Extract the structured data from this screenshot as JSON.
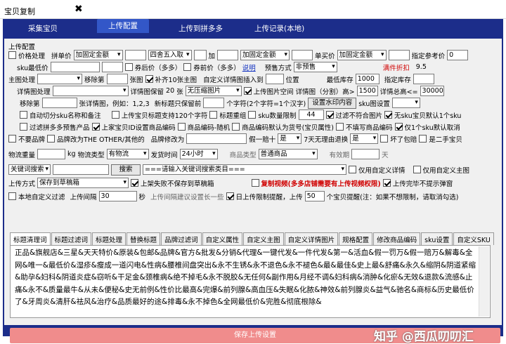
{
  "window": {
    "title": "宝贝复制",
    "close": "✖"
  },
  "nav": [
    "采集宝贝",
    "上传配置",
    "上传到拼多多",
    "上传记录(本地)"
  ],
  "section": "上传配置",
  "r1": {
    "price_cb": "价格处理",
    "group_price": "拼单价",
    "sel1": "加固定金额",
    "sel2": "四舍五入取",
    "add": "加",
    "sel3": "加固定金额",
    "single": "单买价",
    "sel4": "加固定金额",
    "ref": "指定参考价",
    "ref_val": "0"
  },
  "r2": {
    "sku_min": "sku最低价",
    "coupon": "券后价（多多）",
    "before_coupon": "券前价（多多）",
    "explain": "说明",
    "presale": "预售方式",
    "presale_val": "非预售",
    "discount": "满件折扣",
    "discount_val": "9.5"
  },
  "r3": {
    "main_img": "主图处理",
    "move": "移除第",
    "img_tail": "张图",
    "pad": "补齐10张主图",
    "custom_detail": "自定义详情图插入到",
    "pos": "位置",
    "min_stock": "最低库存",
    "min_stock_val": "1000",
    "set_stock": "指定库存"
  },
  "r4": {
    "detail_img": "详情图处理",
    "detail_keep": "详情图保留",
    "keep_num": "20",
    "sheets": "张",
    "keep_sel": "无压缩图片",
    "upload_space": "上传图片空间",
    "split": "详情图（分割）高>",
    "split_val": "1500",
    "detail_total": "详情总高<=",
    "total_val": "30000"
  },
  "r5": {
    "remove": "移除第",
    "example": "张详情图，例如：1,2,3",
    "new_title": "新标题只保留前",
    "chars": "个字符(2个字符=1个汉字)",
    "watermark_btn": "设置水印内容",
    "sku_img": "sku图设置"
  },
  "r6": {
    "auto": "自动切分sku名称和备注",
    "title_len": "上传宝贝标题支持120个字符",
    "title_dup": "标题重组",
    "sku_limit": "sku数量限制",
    "sku_limit_val": "44",
    "filter_cat": "过滤不符合图片",
    "no_sku": "无sku宝贝默认1个sku"
  },
  "r7": {
    "filter_pre": "过滤拼多多预售产品",
    "taobao_code": "上家宝贝ID设置商品编码",
    "random_code": "商品编码-随机",
    "code_default": "商品编码默认为货号(宝贝属性)",
    "no_code": "不填写商品编码",
    "only_one": "仅1个sku默认取消"
  },
  "r8": {
    "no_brand": "不要品牌",
    "brand_other": "品牌改为THE OTHER/其他的",
    "brand_mod": "品牌修改为",
    "fake": "假一赔十",
    "fake_val": "是",
    "seven": "7天无理由退换",
    "seven_val": "是",
    "broken": "坏了包赔",
    "second": "是二手宝贝"
  },
  "r9": {
    "weight": "物流重量",
    "kg": "kg",
    "logistics": "物流类型",
    "log_val": "有物流",
    "ship": "发货时间",
    "ship_val": "24小时",
    "type": "商品类型",
    "type_val": "普通商品",
    "valid": "有效期",
    "days": "天"
  },
  "r10": {
    "keyword": "关键词搜索",
    "search": "搜索",
    "kw_val": "===请输入关键词搜索类目===",
    "custom_detail": "仅用自定义详情",
    "custom_main": "仅用自定义主图"
  },
  "r11": {
    "upload_mode": "上传方式",
    "mode_val": "保存到草稿箱",
    "fail_draft": "上架失败不保存到草稿箱",
    "copy_video": "复制视频(多多店铺需要有上传视频权限)",
    "done_popup": "上传完毕不提示弹窗"
  },
  "r12": {
    "local_filter": "本地自定义过滤",
    "interval": "上传间隔",
    "interval_val": "30",
    "sec": "秒",
    "suggest": "上传间隔建议设置长一些",
    "daily": "日上传限制提醒，上传",
    "daily_val": "50",
    "daily_tail": "个宝贝提醒(注：如果不想限制，请取消勾选)"
  },
  "subtabs": [
    "标题清理词",
    "标题过滤词",
    "标题处理",
    "替换标题",
    "品牌过滤词",
    "自定义属性",
    "自定义主图",
    "自定义详情图片",
    "规格配置",
    "修改商品编码",
    "sku设置",
    "自定义SKU"
  ],
  "content": "正品&旗舰店&三星&天天特价&原装&包邮&品牌&官方&批发&分销&代理&一键代发&一件代发&第一&活血&假一罚万&假一赔万&解毒&全网&唯一&最低价&湿疹&瘦成一道闪电&性病&腰椎间盘突出&永不生锈&永不退色&永不褪色&最&最佳&史上最&舒痛&永久&缩阴&阴道紧缩&助孕&妇科&阴道炎症&窃听&干足金&颈椎病&绝不掉毛&永不脱胶&无任何&副作用&月经不调&妇科病&消肿&化瘀&无效&退款&流感&止痛&永不&质量最牛&从未&便秘&史无前例&性价比最高&完爆&前列腺&高血压&失眠&化脓&神效&前列腺炎&益气&驰名&商标&历史最低价了&牙周炎&清肝&祛风&治疗&品质最好的途&排毒&永不掉色&全网最低价&完胜&彻底根除&",
  "save": "保存上传设置",
  "watermark": "知乎 @西瓜叨叨汇"
}
